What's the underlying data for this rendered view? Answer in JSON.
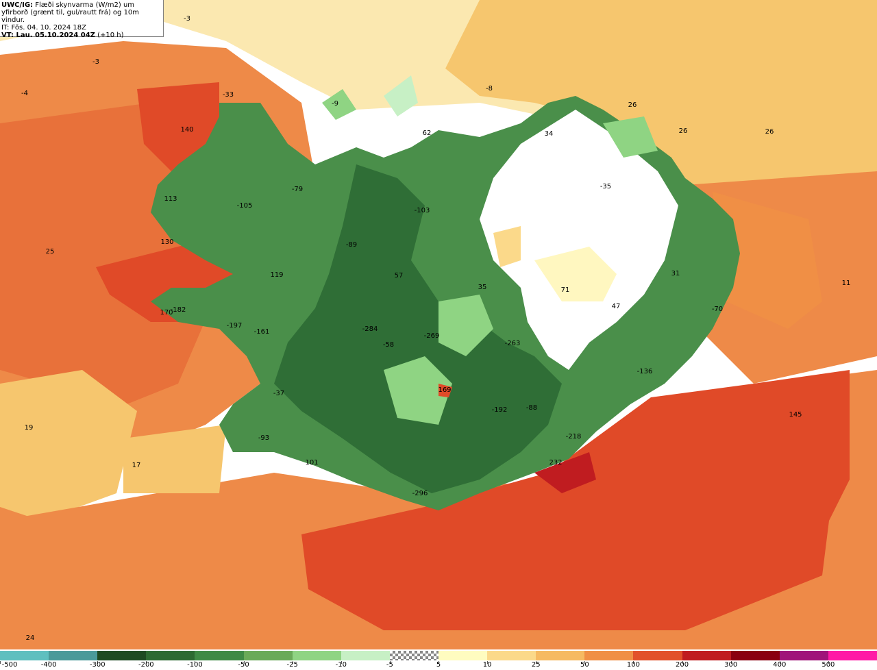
{
  "info": {
    "line1_bold": "UWC/IG:",
    "line1_rest": " Flæði skynvarma (W/m2) um",
    "line2": "yfirborð (grænt til, gul/rautt frá) og 10m vindur.",
    "line3": "IT: Fös. 04. 10. 2024 18Z",
    "line4_bold": "VT: Lau. 05.10.2024 04Z",
    "line4_rest": " (+10 h)"
  },
  "map_labels": [
    "-3",
    "-3",
    "-4",
    "-9",
    "-8",
    "-33",
    "140",
    "62",
    "34",
    "26",
    "26",
    "26",
    "113",
    "-105",
    "-79",
    "-103",
    "-35",
    "25",
    "130",
    "-89",
    "57",
    "35",
    "71",
    "47",
    "31",
    "11",
    "119",
    "170",
    "-182",
    "-197",
    "-161",
    "-284",
    "-58",
    "-269",
    "-263",
    "-70",
    "-136",
    "-37",
    "169",
    "-192",
    "-88",
    "145",
    "19",
    "-93",
    "-218",
    "17",
    "101",
    "232",
    "-296",
    "24"
  ],
  "legend": {
    "colors": [
      "#5fbfbf",
      "#4a9a9a",
      "#1e4a22",
      "#2d6a32",
      "#3f8a45",
      "#6aaa58",
      "#8fd483",
      "#c7f0c5",
      "checker",
      "#fffcc0",
      "#fbd98a",
      "#f6ba62",
      "#f08f45",
      "#e2512a",
      "#c01c20",
      "#8a0010",
      "#a0147a",
      "#ff1aa6"
    ],
    "labels": [
      "-500",
      "-400",
      "-300",
      "-200",
      "-100",
      "-50",
      "-25",
      "-10",
      "-5",
      "5",
      "10",
      "25",
      "50",
      "100",
      "200",
      "300",
      "400",
      "500"
    ]
  },
  "colors": {
    "sea_orange_light": "#f6c66e",
    "sea_orange": "#ee8a48",
    "sea_red": "#e04a28",
    "land_dark_green": "#2f6e36",
    "land_green": "#4a8f4a",
    "land_light_green": "#8fd483",
    "snow_white": "#ffffff",
    "pale_yellow": "#fff7c0"
  }
}
